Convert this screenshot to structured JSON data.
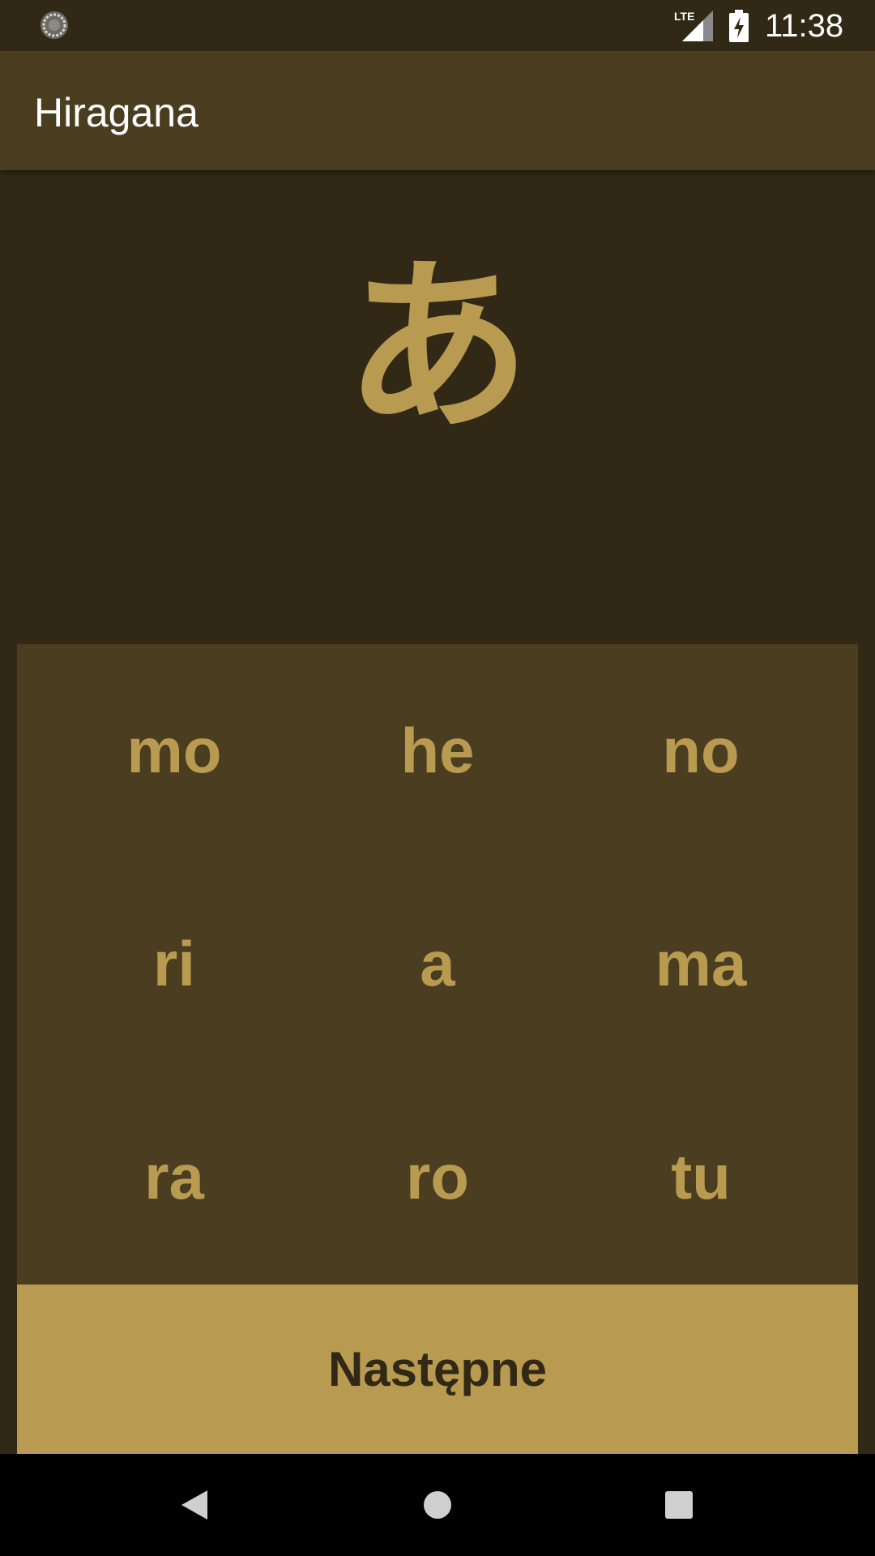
{
  "status_bar": {
    "time": "11:38",
    "network_label": "LTE",
    "icons": [
      "sync-icon",
      "lte-signal-icon",
      "battery-charging-icon"
    ]
  },
  "app_bar": {
    "title": "Hiragana"
  },
  "question": {
    "kana": "あ"
  },
  "answers": [
    "mo",
    "he",
    "no",
    "ri",
    "a",
    "ma",
    "ra",
    "ro",
    "tu"
  ],
  "next_button": {
    "label": "Następne"
  },
  "nav_bar": {
    "icons": [
      "back-icon",
      "home-icon",
      "recents-icon"
    ]
  },
  "colors": {
    "background": "#312916",
    "panel": "#4a3d20",
    "accent": "#b99a51",
    "nav": "#000000"
  }
}
